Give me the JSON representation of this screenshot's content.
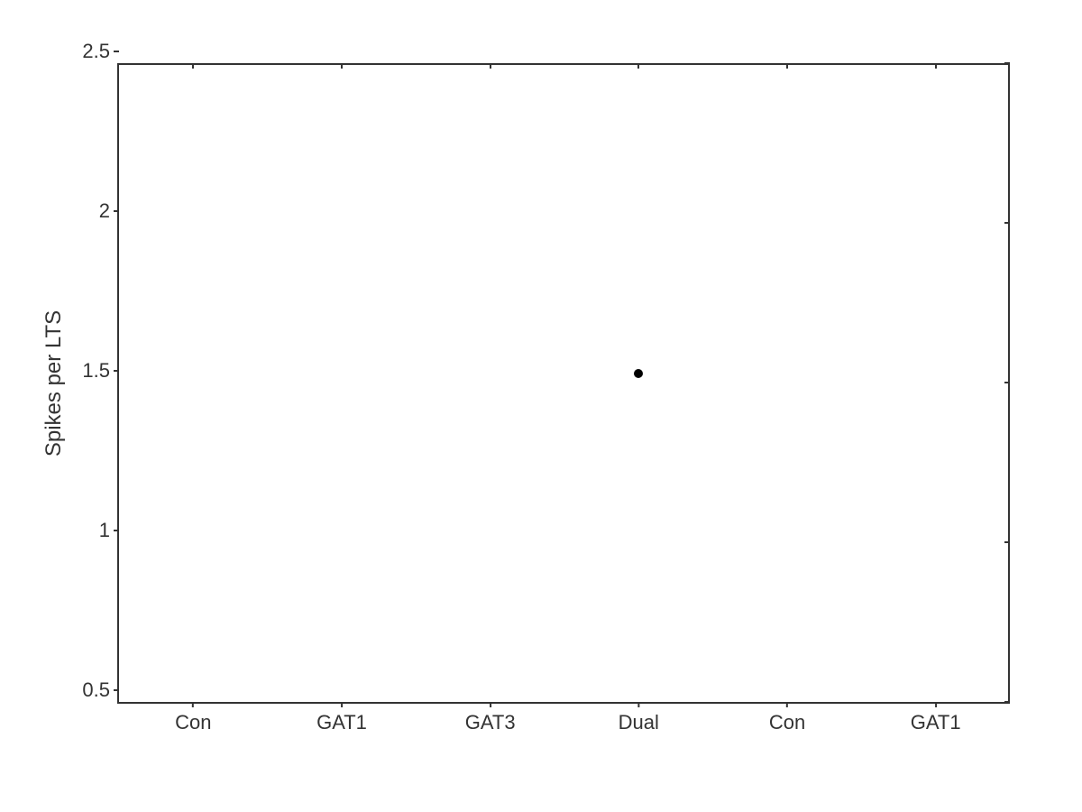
{
  "chart": {
    "title": "",
    "y_axis": {
      "label": "Spikes per LTS",
      "min": 0.5,
      "max": 2.5,
      "ticks": [
        {
          "value": 0.5,
          "label": "0.5",
          "pct": 0
        },
        {
          "value": 1.0,
          "label": "1",
          "pct": 25
        },
        {
          "value": 1.5,
          "label": "1.5",
          "pct": 50
        },
        {
          "value": 2.0,
          "label": "2",
          "pct": 75
        },
        {
          "value": 2.5,
          "label": "2.5",
          "pct": 100
        }
      ]
    },
    "x_axis": {
      "categories": [
        "Con",
        "GAT1",
        "GAT3",
        "Dual",
        "Con",
        "GAT1"
      ],
      "tick_positions": [
        8.33,
        25,
        41.67,
        58.33,
        75,
        91.67
      ]
    },
    "data_points": [
      {
        "x_pct": 58.33,
        "y_value": 1.5,
        "y_pct": 50
      }
    ]
  }
}
